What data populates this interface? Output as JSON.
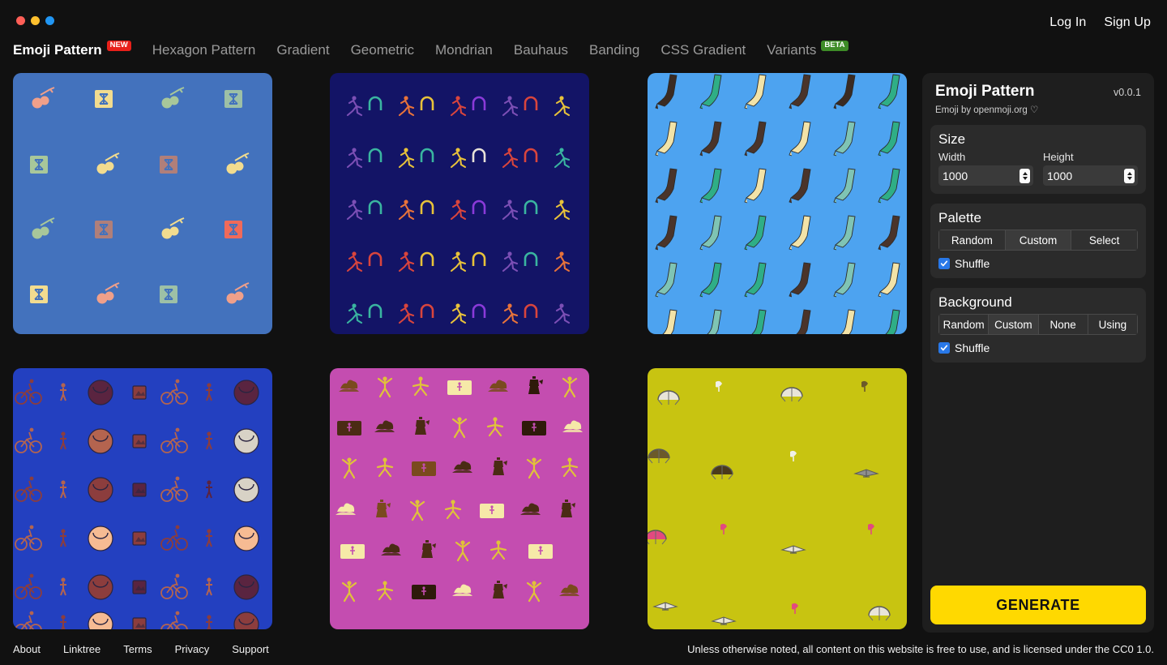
{
  "window": {
    "traffic_lights": [
      {
        "name": "close",
        "color": "#ff5f57"
      },
      {
        "name": "minimize",
        "color": "#ffc02e"
      },
      {
        "name": "maximize",
        "color": "#2196f3"
      }
    ]
  },
  "auth": {
    "login": "Log In",
    "signup": "Sign Up"
  },
  "nav": {
    "items": [
      {
        "label": "Emoji Pattern",
        "active": true,
        "badge": "NEW",
        "badge_color": "#e8201a"
      },
      {
        "label": "Hexagon Pattern",
        "active": false,
        "badge": null
      },
      {
        "label": "Gradient",
        "active": false,
        "badge": null
      },
      {
        "label": "Geometric",
        "active": false,
        "badge": null
      },
      {
        "label": "Mondrian",
        "active": false,
        "badge": null
      },
      {
        "label": "Bauhaus",
        "active": false,
        "badge": null
      },
      {
        "label": "Banding",
        "active": false,
        "badge": null
      },
      {
        "label": "CSS Gradient",
        "active": false,
        "badge": null
      },
      {
        "label": "Variants",
        "active": false,
        "badge": "BETA",
        "badge_color": "#3e8c27"
      }
    ]
  },
  "gallery": {
    "tiles": [
      {
        "name": "tile-cherry-gemini",
        "background": "#4372bd",
        "motifs": [
          "cherries",
          "gemini-square"
        ],
        "colors": [
          "#f0a08a",
          "#f2dc8f",
          "#a8c79a",
          "#b07f7a",
          "#f06a5a",
          "#9dc0a6"
        ]
      },
      {
        "name": "tile-runner-arch",
        "background": "#131466",
        "motifs": [
          "runner",
          "arch"
        ],
        "colors": [
          "#e8c23a",
          "#d9453d",
          "#7c4fb5",
          "#3ab5a0",
          "#e8733a",
          "#8a3ad9"
        ]
      },
      {
        "name": "tile-boot",
        "background": "#4da3f0",
        "motifs": [
          "high-heel-boot"
        ],
        "colors": [
          "#f2e3a8",
          "#4a342a",
          "#2fae86",
          "#7fc4b4",
          "#3b2b22"
        ]
      },
      {
        "name": "tile-medal-cyclist",
        "background": "#2340c0",
        "motifs": [
          "medal",
          "cyclist",
          "person-standing",
          "framed-picture"
        ],
        "colors": [
          "#f6bb93",
          "#8c3d3d",
          "#5a2440",
          "#d8d2c6",
          "#b4644f"
        ]
      },
      {
        "name": "tile-gymnast-trophy",
        "background": "#c44db0",
        "motifs": [
          "gymnast",
          "cartwheel",
          "trophy",
          "moka-pot",
          "ticket"
        ],
        "colors": [
          "#f6e9a8",
          "#e0c23a",
          "#4a2b14",
          "#7a4a1e",
          "#2e1a0a"
        ]
      },
      {
        "name": "tile-paraglider",
        "background": "#c8c411",
        "motifs": [
          "paraglider",
          "parachute",
          "kite",
          "bird"
        ],
        "colors": [
          "#e8e4d8",
          "#e24a7f",
          "#6b5a2a",
          "#8f8f8f",
          "#f0f0e8"
        ]
      }
    ]
  },
  "panel": {
    "title": "Emoji Pattern",
    "version": "v0.0.1",
    "attribution": "Emoji by openmoji.org ♡",
    "size": {
      "title": "Size",
      "width_label": "Width",
      "width_value": "1000",
      "height_label": "Height",
      "height_value": "1000"
    },
    "palette": {
      "title": "Palette",
      "options": [
        "Random",
        "Custom",
        "Select"
      ],
      "selected": "Custom",
      "shuffle_label": "Shuffle",
      "shuffle_checked": true
    },
    "background": {
      "title": "Background",
      "options": [
        "Random",
        "Custom",
        "None",
        "Using"
      ],
      "selected": "Custom",
      "shuffle_label": "Shuffle",
      "shuffle_checked": true
    },
    "generate_label": "GENERATE",
    "accent_color": "#ffd900"
  },
  "footer": {
    "links": [
      "About",
      "Linktree",
      "Terms",
      "Privacy",
      "Support"
    ],
    "note": "Unless otherwise noted, all content on this website is free to use, and is licensed under the CC0 1.0."
  }
}
